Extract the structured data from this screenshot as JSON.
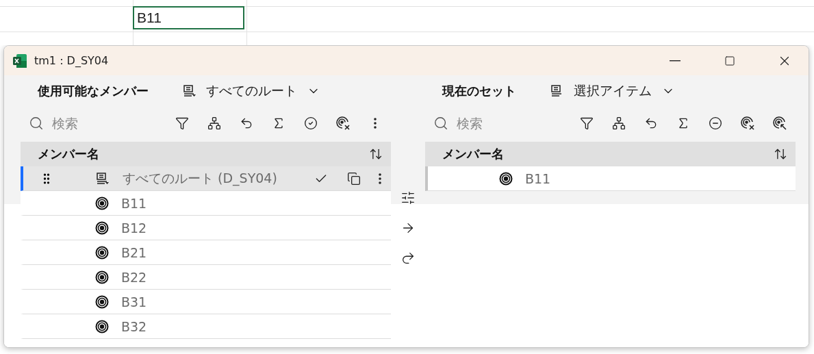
{
  "spreadsheet": {
    "active_cell": "B11"
  },
  "window": {
    "title": "tm1 : D_SY04"
  },
  "available": {
    "title": "使用可能なメンバー",
    "subset": "すべてのルート",
    "search": {
      "placeholder": "検索"
    },
    "column": "メンバー名",
    "parent_row": {
      "label": "すべてのルート (D_SY04)",
      "selected": true
    },
    "members": [
      {
        "label": "B11"
      },
      {
        "label": "B12"
      },
      {
        "label": "B21"
      },
      {
        "label": "B22"
      },
      {
        "label": "B31"
      },
      {
        "label": "B32"
      }
    ]
  },
  "current": {
    "title": "現在のセット",
    "subset": "選択アイテム",
    "search": {
      "placeholder": "検索"
    },
    "column": "メンバー名",
    "members": [
      {
        "label": "B11"
      }
    ]
  }
}
